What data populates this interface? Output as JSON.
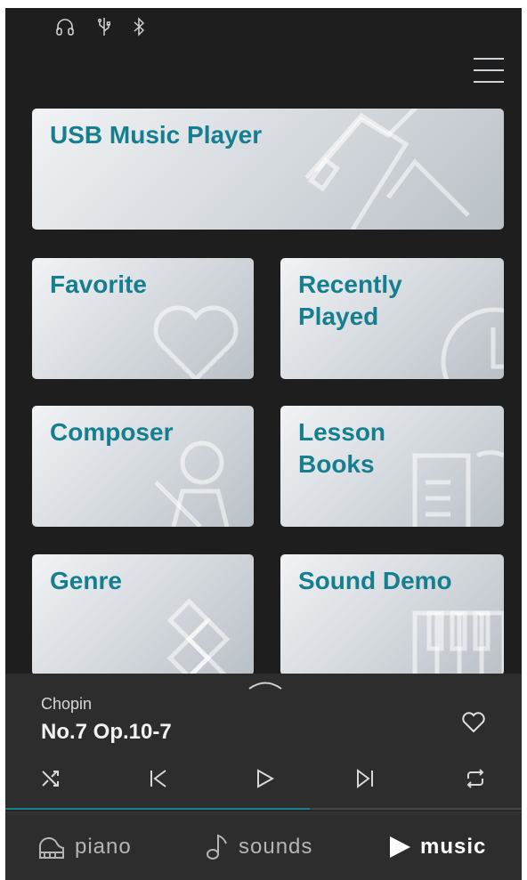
{
  "status_icons": [
    "headphones-icon",
    "usb-icon",
    "bluetooth-icon"
  ],
  "tiles": [
    {
      "id": "usb-music-player",
      "label": "USB Music Player",
      "icon": "usb-drive-icon"
    },
    {
      "id": "favorite",
      "label": "Favorite",
      "icon": "heart-icon"
    },
    {
      "id": "recently-played",
      "label": "Recently\nPlayed",
      "icon": "clock-icon"
    },
    {
      "id": "composer",
      "label": "Composer",
      "icon": "person-icon"
    },
    {
      "id": "lesson-books",
      "label": "Lesson\nBooks",
      "icon": "book-icon"
    },
    {
      "id": "genre",
      "label": "Genre",
      "icon": "genre-icon"
    },
    {
      "id": "sound-demo",
      "label": "Sound Demo",
      "icon": "keyboard-icon"
    }
  ],
  "player": {
    "artist": "Chopin",
    "title": "No.7 Op.10-7",
    "progress": 0.59
  },
  "nav": {
    "piano": "piano",
    "sounds": "sounds",
    "music": "music",
    "active": "music"
  },
  "colors": {
    "accent": "#157f8f",
    "background": "#1e1e1e",
    "panel": "#2d2d2d"
  }
}
